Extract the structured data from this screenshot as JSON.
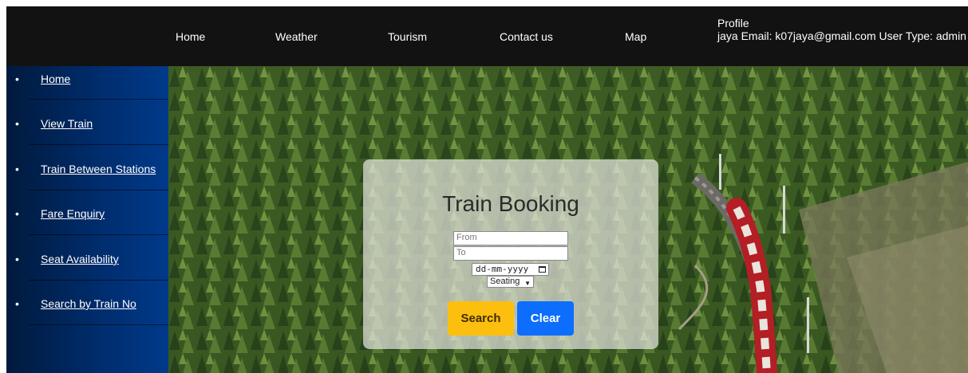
{
  "nav": {
    "items": [
      "Home",
      "Weather",
      "Tourism",
      "Contact us",
      "Map"
    ],
    "profile_title": "Profile",
    "profile_details": "jaya Email: k07jaya@gmail.com User Type: admin"
  },
  "sidebar": {
    "bullet": "•",
    "items": [
      "Home",
      "View Train",
      "Train Between Stations",
      "Fare Enquiry",
      "Seat Availability",
      "Search by Train No"
    ]
  },
  "booking": {
    "title": "Train Booking",
    "from_placeholder": "From",
    "to_placeholder": "To",
    "date_placeholder": "dd-mm-yyyy",
    "class_selected": "Seating",
    "search_label": "Search",
    "clear_label": "Clear"
  },
  "colors": {
    "topbar": "#121212",
    "sidebar_dark": "#001a3d",
    "search_button": "#fdbf0e",
    "clear_button": "#0d6efd"
  },
  "icons": {
    "date": "calendar-icon",
    "select": "chevron-down-icon"
  }
}
